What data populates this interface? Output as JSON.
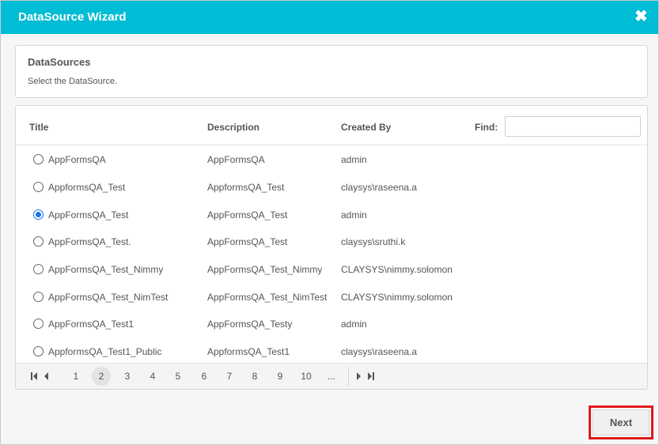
{
  "dialog": {
    "title": "DataSource Wizard",
    "close_icon": "close-icon",
    "accent_color": "#00bcd4"
  },
  "section": {
    "title": "DataSources",
    "subtitle": "Select the DataSource."
  },
  "grid": {
    "columns": [
      "Title",
      "Description",
      "Created By"
    ],
    "find_label": "Find:",
    "find_value": "",
    "rows": [
      {
        "title": "AppFormsQA",
        "description": "AppFormsQA",
        "created_by": "admin",
        "selected": false
      },
      {
        "title": "AppformsQA_Test",
        "description": "AppformsQA_Test",
        "created_by": "claysys\\raseena.a",
        "selected": false
      },
      {
        "title": "AppFormsQA_Test",
        "description": "AppFormsQA_Test",
        "created_by": "admin",
        "selected": true
      },
      {
        "title": "AppFormsQA_Test.",
        "description": "AppFormsQA_Test",
        "created_by": "claysys\\sruthi.k",
        "selected": false
      },
      {
        "title": "AppFormsQA_Test_Nimmy",
        "description": "AppFormsQA_Test_Nimmy",
        "created_by": "CLAYSYS\\nimmy.solomon",
        "selected": false
      },
      {
        "title": "AppFormsQA_Test_NimTest",
        "description": "AppFormsQA_Test_NimTest",
        "created_by": "CLAYSYS\\nimmy.solomon",
        "selected": false
      },
      {
        "title": "AppFormsQA_Test1",
        "description": "AppFormsQA_Testy",
        "created_by": "admin",
        "selected": false
      },
      {
        "title": "AppformsQA_Test1_Public",
        "description": "AppformsQA_Test1",
        "created_by": "claysys\\raseena.a",
        "selected": false
      }
    ]
  },
  "pager": {
    "pages": [
      "1",
      "2",
      "3",
      "4",
      "5",
      "6",
      "7",
      "8",
      "9",
      "10",
      "..."
    ],
    "current_page": "2"
  },
  "footer": {
    "next_label": "Next",
    "highlight_color": "#e0191b"
  }
}
